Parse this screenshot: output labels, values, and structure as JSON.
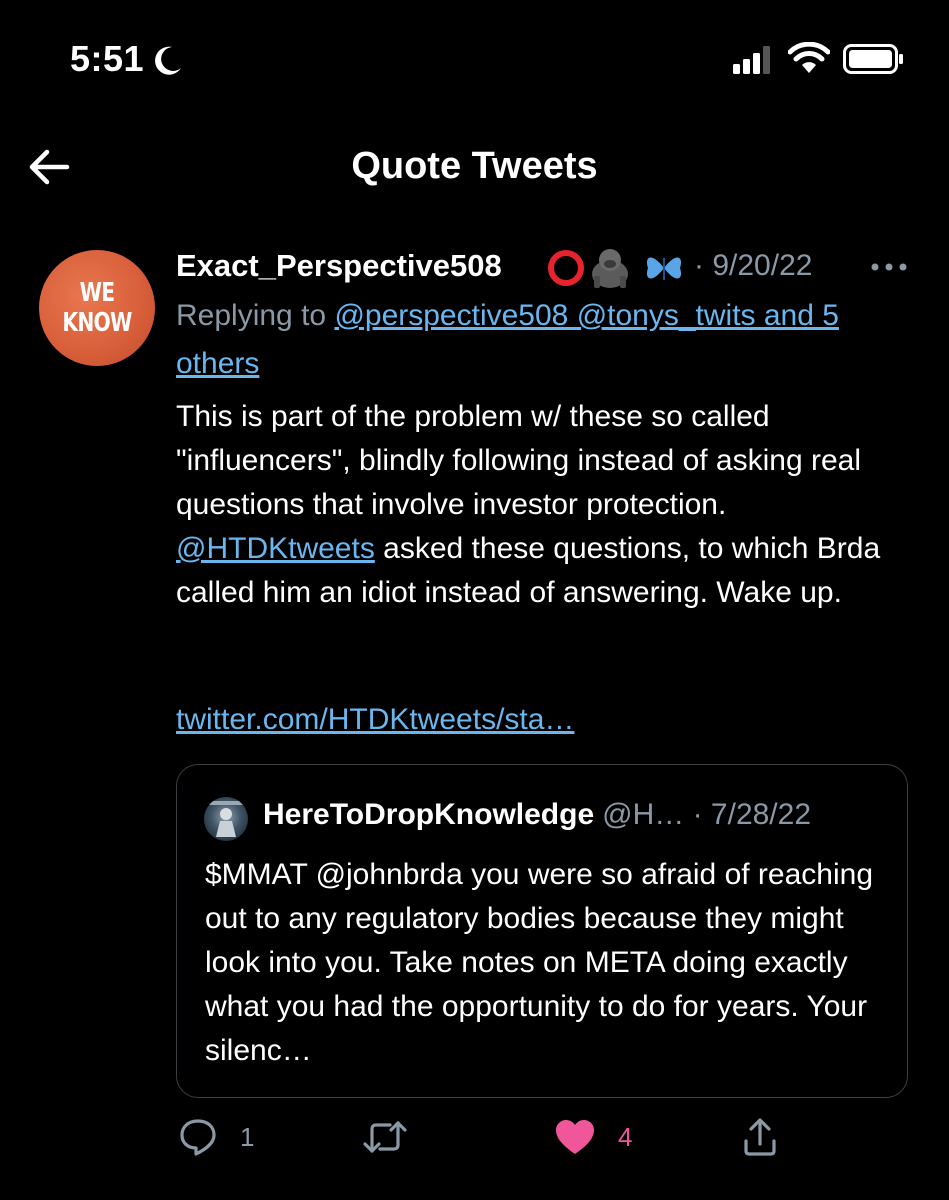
{
  "status_bar": {
    "time": "5:51",
    "icons": [
      "moon-icon",
      "signal-icon",
      "wifi-icon",
      "battery-icon"
    ]
  },
  "header": {
    "title": "Quote Tweets",
    "back_icon": "back-arrow-icon"
  },
  "tweet": {
    "avatar_text": [
      "WE",
      "KNOW"
    ],
    "display_name": "Exact_Perspective508",
    "name_emojis": [
      "red-circle-icon",
      "gorilla-icon",
      "butterfly-icon"
    ],
    "date_separator": "·",
    "date": "9/20/22",
    "replying_prefix": "Replying to",
    "replying_links": "@perspective508 @tonys_twits and 5 others",
    "body_line_1": "This is part of the problem w/ these so called \"influencers\", blindly following instead of asking real questions that involve investor protection.",
    "mention": "@HTDKtweets",
    "body_line_2": " asked these questions, to which Brda called him an idiot instead of answering. Wake up.",
    "url": "twitter.com/HTDKtweets/sta…"
  },
  "quoted_tweet": {
    "name": "HereToDropKnowledge",
    "handle_date": "@H… · 7/28/22",
    "body": "$MMAT @johnbrda you were so afraid of reaching out to any regulatory bodies because they might look into you. Take notes on META doing exactly what you had the opportunity to do for years. Your silenc…"
  },
  "actions": {
    "reply_count": "1",
    "retweet_count": "",
    "like_count": "4",
    "colors": {
      "icon": "#8b98a5",
      "like": "#f0569a",
      "link": "#6ab7f0"
    }
  }
}
